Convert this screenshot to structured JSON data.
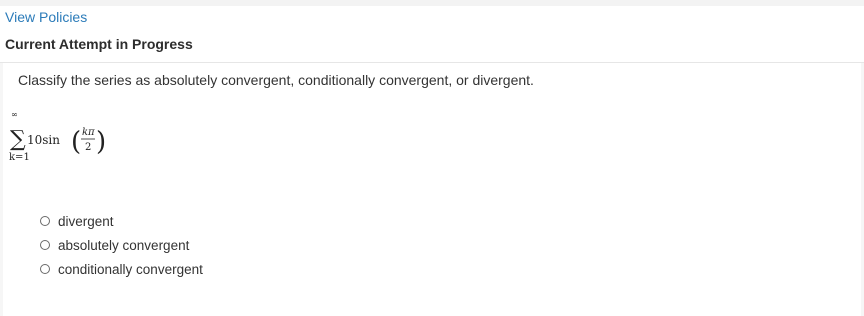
{
  "header": {
    "view_policies_link": "View Policies",
    "attempt_status": "Current Attempt in Progress"
  },
  "question": {
    "prompt": "Classify the series as absolutely convergent, conditionally convergent, or divergent.",
    "expression": {
      "sum_upper": "∞",
      "sum_lower": "k=1",
      "coefficient_function": "10sin",
      "numerator": "kπ",
      "denominator": "2"
    },
    "options": [
      {
        "label": "divergent",
        "selected": false
      },
      {
        "label": "absolutely convergent",
        "selected": false
      },
      {
        "label": "conditionally convergent",
        "selected": false
      }
    ]
  },
  "colors": {
    "link": "#2b7bb9",
    "background": "#f6f6f6",
    "card": "#ffffff"
  }
}
